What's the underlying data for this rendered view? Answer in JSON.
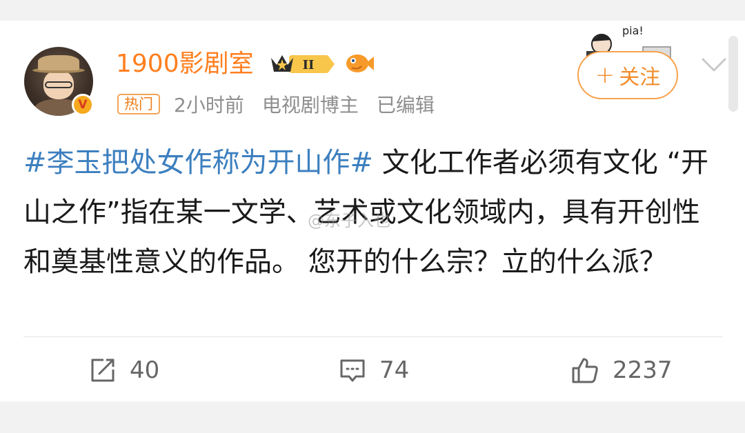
{
  "post": {
    "username": "1900影剧室",
    "vip_level": "II",
    "verify_mark": "V",
    "hot_tag": "热门",
    "time": "2小时前",
    "category": "电视剧博主",
    "edited": "已编辑",
    "follow_label": "关注",
    "follow_plus": "+",
    "pia_text": "pia!",
    "hashtag": "#李玉把处女作称为开山作#",
    "body": " 文化工作者必须有文化 “开山之作”指在某一文学、艺术或文化领域内，具有开创性和奠基性意义的作品。 您开的什么宗？立的什么派？",
    "watermark": "@东子入也"
  },
  "actions": {
    "repost_count": "40",
    "comment_count": "74",
    "like_count": "2237"
  },
  "colors": {
    "username": "#ff7f1f",
    "hashtag": "#3c7fbf",
    "follow": "#f28d2c",
    "meta": "#8e8e8e"
  },
  "icons": {
    "repost": "share-icon",
    "comment": "comment-icon",
    "like": "thumbs-up-icon",
    "more": "chevron-down-icon"
  }
}
